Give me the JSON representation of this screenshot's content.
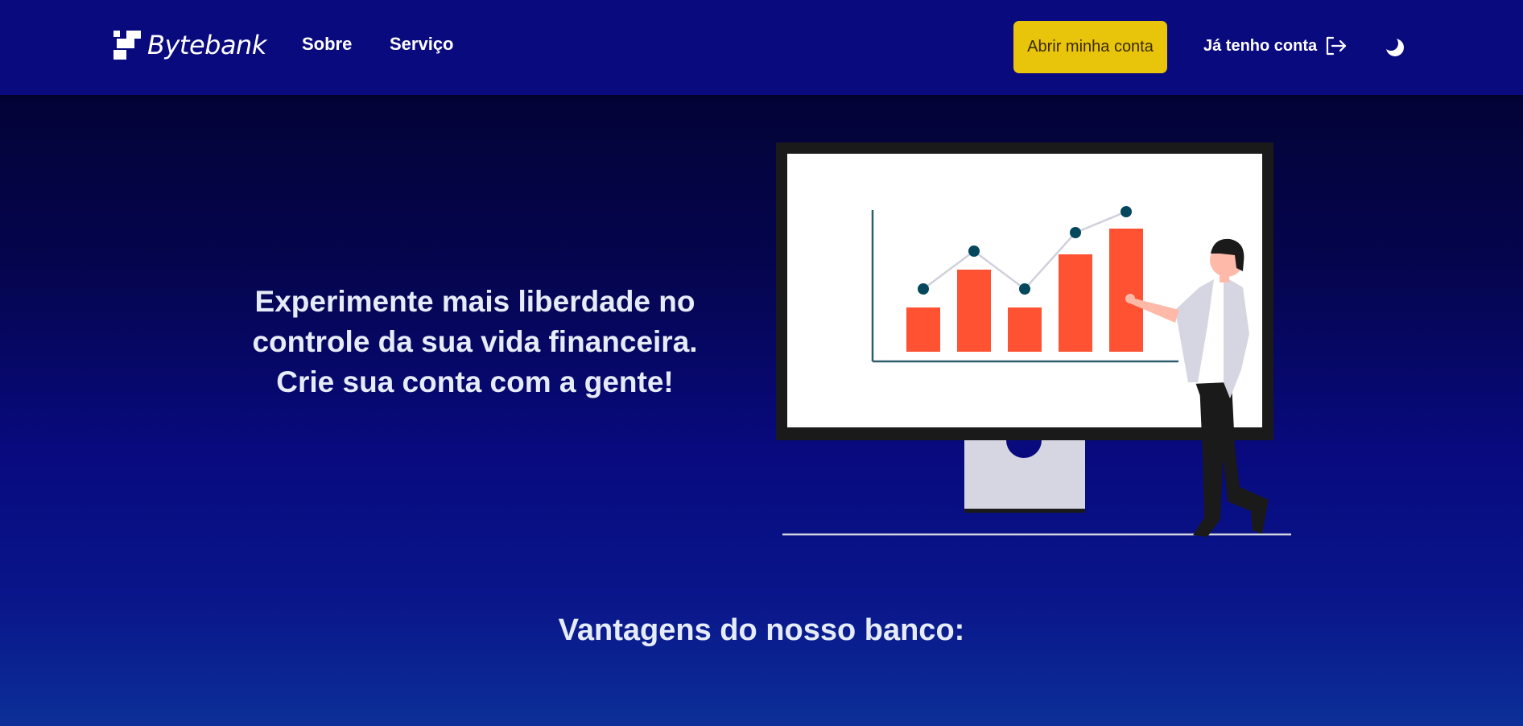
{
  "brand": {
    "name": "Bytebank"
  },
  "nav": {
    "links": [
      "Sobre",
      "Serviço"
    ],
    "cta_label": "Abrir minha conta",
    "login_label": "Já tenho conta",
    "theme_icon": "moon-icon",
    "login_icon": "sign-in-icon"
  },
  "hero": {
    "lines": [
      "Experimente mais liberdade no",
      "controle da sua vida financeira.",
      "Crie sua conta com a gente!"
    ]
  },
  "advantages": {
    "title": "Vantagens do nosso banco:"
  },
  "colors": {
    "navbar": "#0a0a7f",
    "cta": "#e8c50a",
    "bars": "#ff5233",
    "line_points": "#05485e",
    "text": "#e6ecf7"
  }
}
